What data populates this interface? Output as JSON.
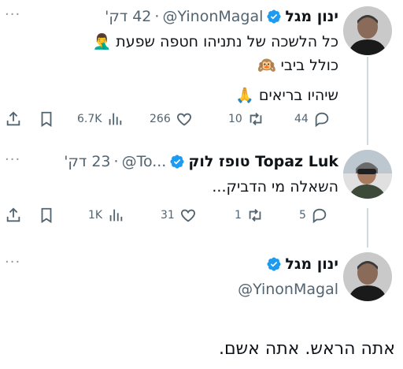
{
  "tweet1": {
    "name": "ינון מגל",
    "handle": "@YinonMagal",
    "separator": "·",
    "time": "42 דק'",
    "more": "···",
    "lines": [
      "כל הלשכה של נתניהו חטפה שפעת",
      "כולל ביבי",
      "שיהיו בריאים"
    ],
    "emojis": [
      "🤦‍♂️",
      "🙉",
      "🙏"
    ],
    "stats": {
      "views": "6.7K",
      "likes": "266",
      "retweets": "10",
      "replies": "44"
    }
  },
  "tweet2": {
    "name": "טופז לוק Topaz Luk",
    "handle": "@To...",
    "separator": "·",
    "time": "23 דק'",
    "more": "···",
    "lines": [
      "השאלה מי הדביק..."
    ],
    "stats": {
      "views": "1K",
      "likes": "31",
      "retweets": "1",
      "replies": "5"
    }
  },
  "tweet3": {
    "name": "ינון מגל",
    "handle": "@YinonMagal",
    "more": "···"
  },
  "bottom_text": "אתה הראש. אתה אשם.",
  "colors": {
    "verified": "#1d9bf0",
    "secondary": "#536471",
    "line": "#cfd9de"
  },
  "icons": [
    "share-icon",
    "bookmark-icon",
    "views-icon",
    "heart-icon",
    "retweet-icon",
    "reply-icon",
    "verified-icon"
  ]
}
